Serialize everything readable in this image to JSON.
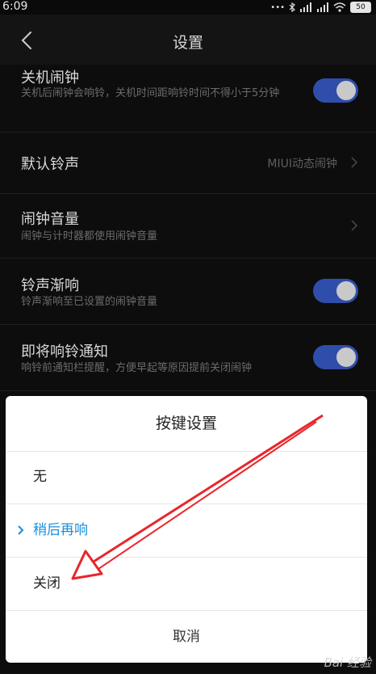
{
  "status_bar": {
    "time": "6:09",
    "battery": "50",
    "icons": [
      "more-dots-icon",
      "bluetooth-icon",
      "signal-icon",
      "signal-icon-2",
      "wifi-icon"
    ]
  },
  "nav": {
    "title": "设置",
    "back_icon": "chevron-left-icon"
  },
  "settings": {
    "rows": [
      {
        "title": "关机闹钟",
        "subtitle": "关机后闹钟会响铃，关机时间距响铃时间不得小于5分钟",
        "toggle": true
      },
      {
        "title": "默认铃声",
        "value": "MIUI动态闹钟",
        "chevron": true
      },
      {
        "title": "闹钟音量",
        "subtitle": "闹钟与计时器都使用闹钟音量",
        "chevron": true
      },
      {
        "title": "铃声渐响",
        "subtitle": "铃声渐响至已设置的闹钟音量",
        "toggle": true
      },
      {
        "title": "即将响铃通知",
        "subtitle": "响铃前通知栏提醒，方便早起等原因提前关闭闹钟",
        "toggle": true
      }
    ]
  },
  "dialog": {
    "title": "按键设置",
    "options": [
      {
        "label": "无",
        "selected": false
      },
      {
        "label": "稍后再响",
        "selected": true
      },
      {
        "label": "关闭",
        "selected": false
      }
    ],
    "cancel_label": "取消"
  },
  "colors": {
    "accent": "#1a90d8",
    "toggle_on": "#2f4dab",
    "annotation_arrow": "#e8262b"
  },
  "watermark": "Bai 经验"
}
